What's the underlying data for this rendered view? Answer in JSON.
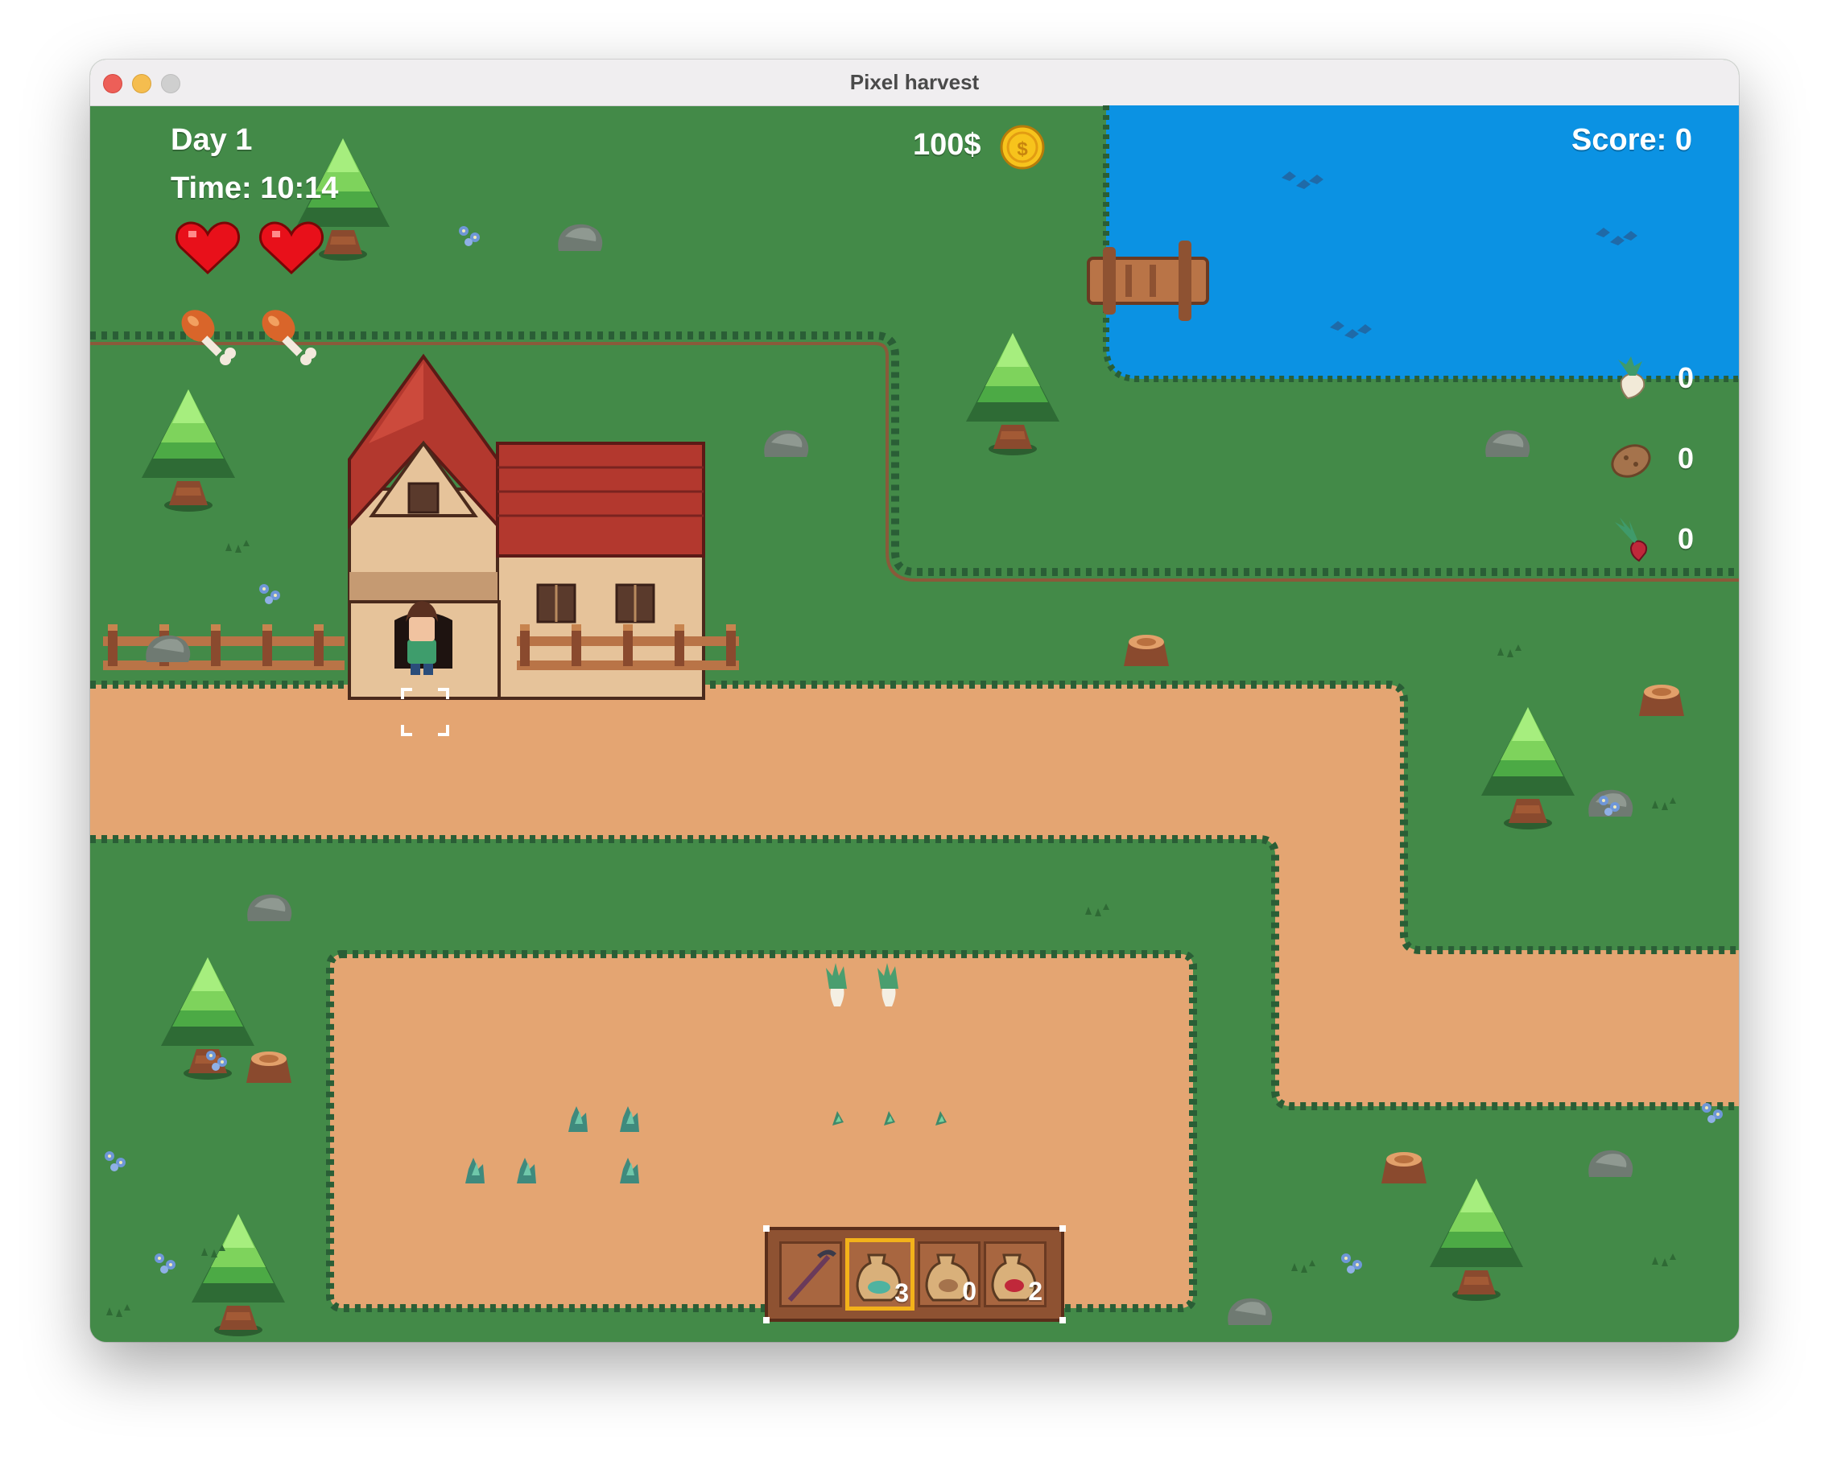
{
  "window": {
    "title": "Pixel harvest"
  },
  "hud": {
    "day": "Day 1",
    "time": "Time: 10:14",
    "money": "100$",
    "score": "Score: 0",
    "hearts": 2,
    "food": 2
  },
  "inventory": [
    {
      "item": "turnip",
      "icon": "turnip-icon",
      "count": "0"
    },
    {
      "item": "potato",
      "icon": "potato-icon",
      "count": "0"
    },
    {
      "item": "beet",
      "icon": "beet-icon",
      "count": "0"
    }
  ],
  "toolbar": {
    "selected_slot": 1,
    "slots": [
      {
        "item": "hoe",
        "icon": "hoe-icon",
        "count": ""
      },
      {
        "item": "turnip-seeds",
        "icon": "seed-bag-icon",
        "count": "3"
      },
      {
        "item": "potato-seeds",
        "icon": "seed-bag-icon",
        "count": "0"
      },
      {
        "item": "beet-seeds",
        "icon": "seed-bag-icon",
        "count": "2"
      }
    ]
  },
  "colors": {
    "grass": "#438a48",
    "path": "#e4a572",
    "water": "#0b92e3",
    "roof": "#b3382e",
    "wall": "#e6c39a",
    "heart": "#e8101a",
    "coin": "#f7c31c",
    "hud_text": "#ffffff",
    "selected_slot": "#f3b21a"
  }
}
